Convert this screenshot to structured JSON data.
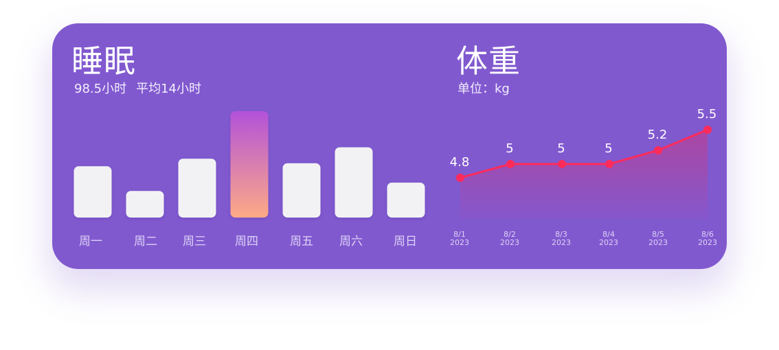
{
  "sleep": {
    "title": "睡眠",
    "total": "98.5小时",
    "average": "平均14小时"
  },
  "weight": {
    "title": "体重",
    "unit_label": "单位：kg"
  },
  "colors": {
    "card": "#8159cf",
    "bar": "#f2f2f4",
    "highlight_top": "#b352d9",
    "highlight_bottom": "#fdaa86",
    "line": "#ff2b5a",
    "area_top": "#e0306d"
  },
  "chart_data": [
    {
      "type": "bar",
      "categories": [
        "周一",
        "周二",
        "周三",
        "周四",
        "周五",
        "周六",
        "周日"
      ],
      "values": [
        13.5,
        7,
        15.5,
        28,
        14.3,
        18.5,
        9.2
      ],
      "highlight_index": 3,
      "grid": false,
      "legend": "none"
    },
    {
      "type": "line",
      "x": [
        "8/1",
        "8/2",
        "8/3",
        "8/4",
        "8/5",
        "8/6"
      ],
      "x_year": "2023",
      "values": [
        4.8,
        5,
        5,
        5,
        5.2,
        5.5
      ],
      "labels": [
        "4.8",
        "5",
        "5",
        "5",
        "5.2",
        "5.5"
      ],
      "ylim": [
        4,
        5.9
      ],
      "area_fill": true,
      "grid": false,
      "legend": "none"
    }
  ]
}
